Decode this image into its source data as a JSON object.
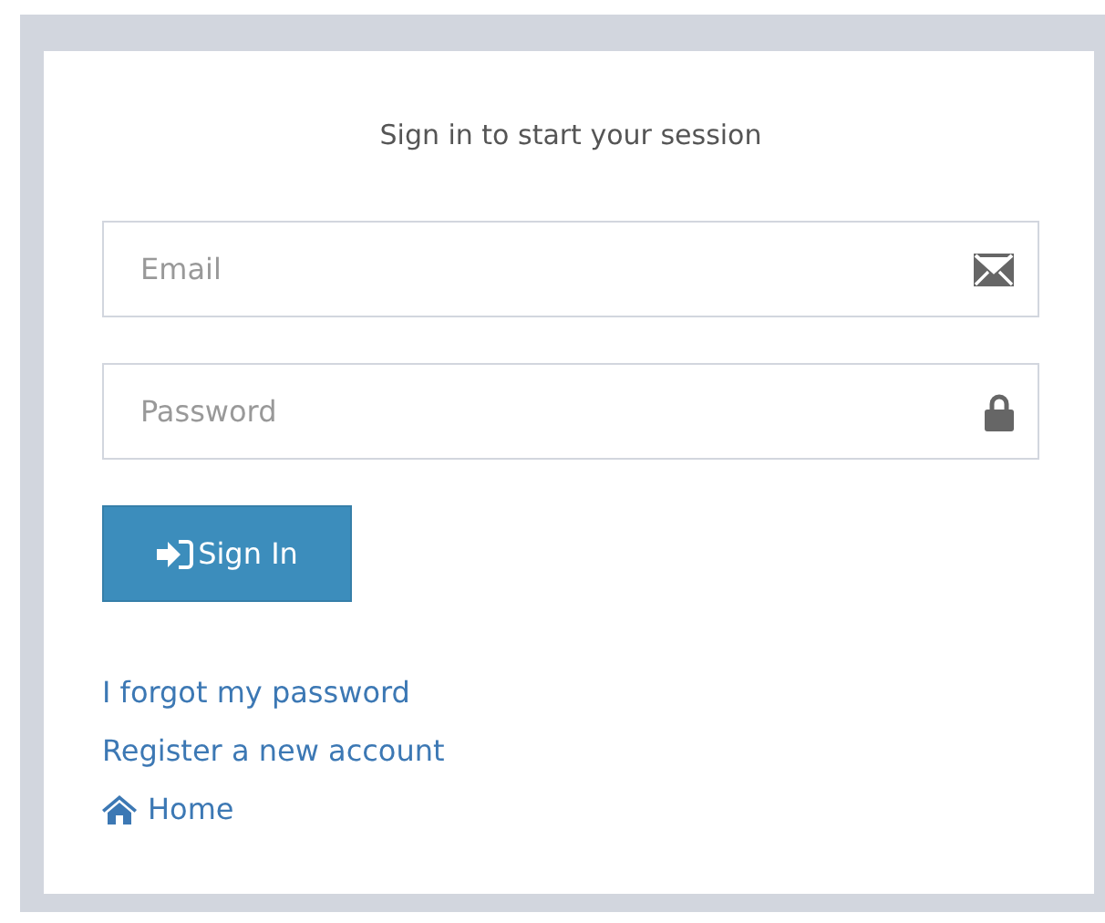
{
  "heading": "Sign in to start your session",
  "fields": [
    {
      "kind": "email",
      "placeholder": "Email"
    },
    {
      "kind": "password",
      "placeholder": "Password"
    }
  ],
  "button": {
    "label": "Sign In"
  },
  "links": [
    {
      "kind": "plain",
      "label": "I forgot my password"
    },
    {
      "kind": "plain",
      "label": "Register a new account"
    },
    {
      "kind": "home",
      "label": "Home"
    }
  ]
}
